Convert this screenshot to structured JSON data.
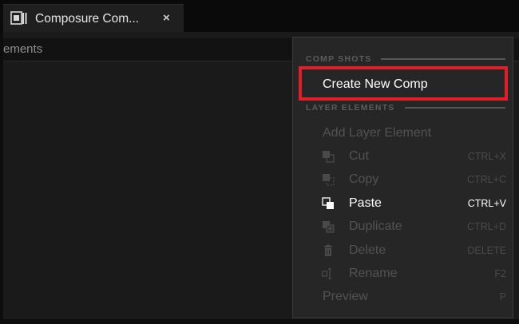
{
  "tab": {
    "title": "Composure Com...",
    "close_glyph": "×",
    "icon": "composure-icon"
  },
  "panel": {
    "header_text": "ements"
  },
  "menu": {
    "sections": [
      {
        "title": "COMP SHOTS"
      },
      {
        "title": "LAYER ELEMENTS"
      }
    ],
    "items": [
      {
        "label": "Create New Comp",
        "shortcut": "",
        "enabled": true,
        "icon": ""
      },
      {
        "label": "Add Layer Element",
        "shortcut": "",
        "enabled": false,
        "icon": ""
      },
      {
        "label": "Cut",
        "shortcut": "CTRL+X",
        "enabled": false,
        "icon": "cut-icon"
      },
      {
        "label": "Copy",
        "shortcut": "CTRL+C",
        "enabled": false,
        "icon": "copy-icon"
      },
      {
        "label": "Paste",
        "shortcut": "CTRL+V",
        "enabled": true,
        "icon": "paste-icon"
      },
      {
        "label": "Duplicate",
        "shortcut": "CTRL+D",
        "enabled": false,
        "icon": "duplicate-icon"
      },
      {
        "label": "Delete",
        "shortcut": "DELETE",
        "enabled": false,
        "icon": "delete-icon"
      },
      {
        "label": "Rename",
        "shortcut": "F2",
        "enabled": false,
        "icon": "rename-icon"
      },
      {
        "label": "Preview",
        "shortcut": "P",
        "enabled": false,
        "icon": ""
      }
    ]
  },
  "highlight_color": "#e01f2a",
  "accent_text_color": "#ffffff",
  "disabled_text_color": "#525252"
}
